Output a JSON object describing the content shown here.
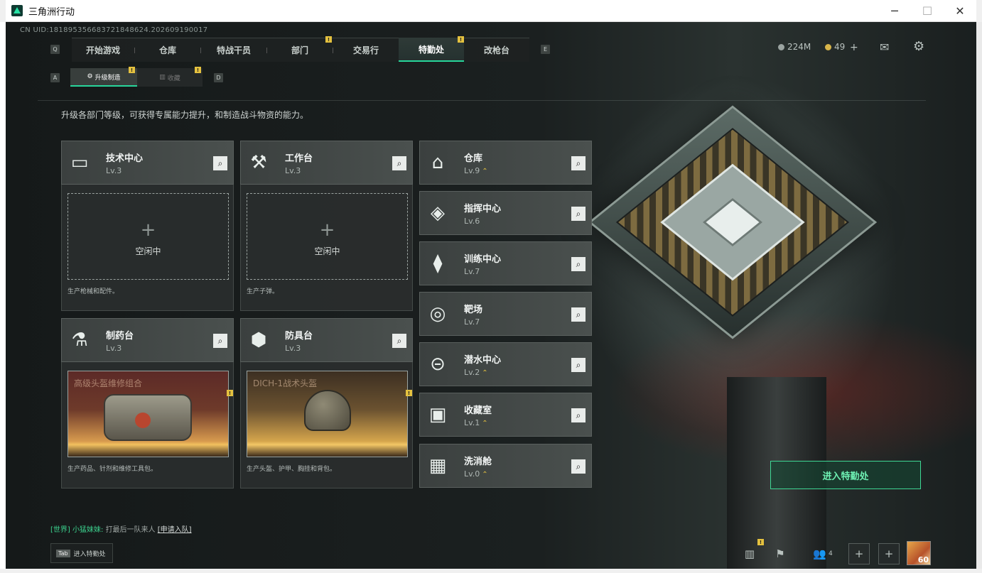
{
  "window": {
    "title": "三角洲行动",
    "min": "─",
    "max": "☐",
    "close": "✕"
  },
  "uid": "CN UID:181895356683721848624.202609190017",
  "nav": {
    "key_left": "Q",
    "key_right": "E",
    "tabs": [
      "开始游戏",
      "仓库",
      "特战干员",
      "部门",
      "交易行",
      "特勤处",
      "改枪台"
    ],
    "active": "特勤处"
  },
  "subnav": {
    "key_left": "A",
    "key_right": "D",
    "tabs": [
      "升级制造",
      "收藏"
    ]
  },
  "currency": {
    "money": "224M",
    "coins": "49",
    "add": "+"
  },
  "badge_mark": "!",
  "description": "升级各部门等级，可获得专属能力提升，和制造战斗物资的能力。",
  "stations": [
    {
      "name": "技术中心",
      "level": "Lv.3",
      "slot": "空闲中",
      "product": "生产枪械和配件。"
    },
    {
      "name": "工作台",
      "level": "Lv.3",
      "slot": "空闲中",
      "product": "生产子弹。"
    },
    {
      "name": "制药台",
      "level": "Lv.3",
      "item": "高级头盔维修组合",
      "product": "生产药品、针剂和维修工具包。"
    },
    {
      "name": "防具台",
      "level": "Lv.3",
      "item": "DICH-1战术头盔",
      "product": "生产头盔、护甲、胸挂和背包。"
    }
  ],
  "plus": "+",
  "departments": [
    {
      "name": "仓库",
      "level": "Lv.9",
      "upgrade": true
    },
    {
      "name": "指挥中心",
      "level": "Lv.6",
      "upgrade": false
    },
    {
      "name": "训练中心",
      "level": "Lv.7",
      "upgrade": false
    },
    {
      "name": "靶场",
      "level": "Lv.7",
      "upgrade": false
    },
    {
      "name": "潜水中心",
      "level": "Lv.2",
      "upgrade": true
    },
    {
      "name": "收藏室",
      "level": "Lv.1",
      "upgrade": true
    },
    {
      "name": "洗消舱",
      "level": "Lv.0",
      "upgrade": true
    }
  ],
  "upgrade_mark": "⌃",
  "enter_button": "进入特勤处",
  "chat": {
    "channel": "[世界]",
    "user": "小猛妹妹:",
    "message": "打最后一队来人",
    "link": "[申请入队]"
  },
  "tab_hint": {
    "key": "Tab",
    "label": "进入特勤处"
  },
  "friends_count": "4",
  "avatar_level": "60"
}
